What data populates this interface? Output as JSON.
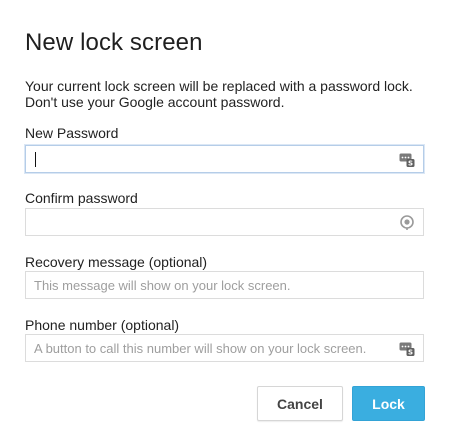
{
  "dialog": {
    "title": "New lock screen",
    "description_lines": [
      "Your current lock screen will be replaced with a password lock.",
      "Don't use your Google account password."
    ]
  },
  "fields": [
    {
      "label": "New Password",
      "value": "",
      "placeholder": "",
      "focused": true,
      "icon": "password-manager-icon"
    },
    {
      "label": "Confirm password",
      "value": "",
      "placeholder": "",
      "focused": false,
      "icon": "status-indicator-icon"
    },
    {
      "label": "Recovery message (optional)",
      "value": "",
      "placeholder": "This message will show on your lock screen.",
      "focused": false,
      "icon": ""
    },
    {
      "label": "Phone number (optional)",
      "value": "",
      "placeholder": "A button to call this number will show on your lock screen.",
      "focused": false,
      "icon": "password-manager-icon"
    }
  ],
  "buttons": {
    "cancel_label": "Cancel",
    "lock_label": "Lock"
  },
  "colors": {
    "accent": "#3aaee0",
    "focus_border": "#b5cde8",
    "border": "#dcdcdc",
    "placeholder": "#9e9e9e"
  }
}
